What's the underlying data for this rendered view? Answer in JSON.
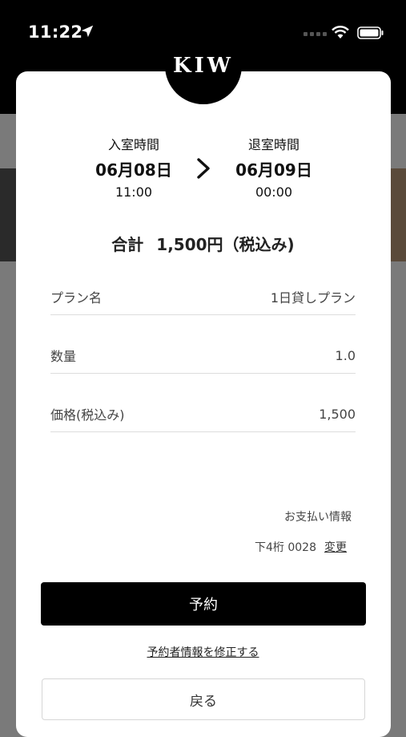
{
  "status_bar": {
    "time": "11:22"
  },
  "logo": {
    "text": "KIW"
  },
  "check_in": {
    "label": "入室時間",
    "date": "06月08日",
    "time": "11:00"
  },
  "check_out": {
    "label": "退室時間",
    "date": "06月09日",
    "time": "00:00"
  },
  "total": {
    "label": "合計",
    "amount": "1,500円（税込み)"
  },
  "details": [
    {
      "label": "プラン名",
      "value": "1日貸しプラン"
    },
    {
      "label": "数量",
      "value": "1.0"
    },
    {
      "label": "価格(税込み)",
      "value": "1,500"
    }
  ],
  "payment": {
    "label": "お支払い情報",
    "card_last4": "下4桁 0028",
    "change_label": "変更"
  },
  "actions": {
    "reserve_label": "予約",
    "edit_info_label": "予約者情報を修正する",
    "back_label": "戻る"
  },
  "colors": {
    "primary_button": "#000000",
    "background": "#ffffff",
    "overlay": "#7a7a7a"
  }
}
